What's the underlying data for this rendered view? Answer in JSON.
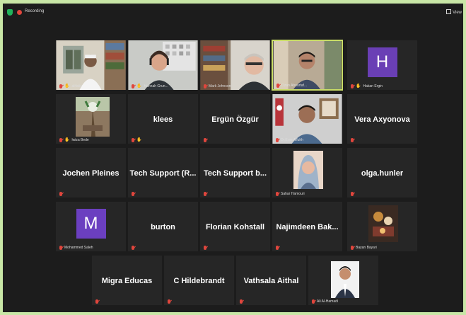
{
  "topbar": {
    "recording": "Recording",
    "view": "View"
  },
  "colors": {
    "accent_border": "#c9dd67",
    "mic_muted": "#e0463d",
    "avatar_purple": "#6a3fb5",
    "avatar_purple2": "#6b3fc0"
  },
  "participants": [
    {
      "id": "p1",
      "label": "alifatis"
    },
    {
      "id": "p2",
      "label": "Hannah Grun..."
    },
    {
      "id": "p3",
      "label": "Mark Johnson"
    },
    {
      "id": "p4",
      "label": "Ozan Abourtaf..."
    },
    {
      "id": "p5",
      "label": "Hakan Ergin",
      "avatar": "H"
    },
    {
      "id": "p6",
      "label": "lwiza Bede"
    },
    {
      "id": "p7",
      "name": "klees"
    },
    {
      "id": "p8",
      "name": "Ergün Özgür"
    },
    {
      "id": "p9",
      "label": "Dr.Eras Alfuhh"
    },
    {
      "id": "p10",
      "name": "Vera Axyonova"
    },
    {
      "id": "p11",
      "name": "Jochen Pleines"
    },
    {
      "id": "p12",
      "name": "Tech Support (R..."
    },
    {
      "id": "p13",
      "name": "Tech Support b..."
    },
    {
      "id": "p14",
      "label": "Sahar Hamouri"
    },
    {
      "id": "p15",
      "name": "olga.hunler"
    },
    {
      "id": "p16",
      "label": "Mohammed Saleh",
      "avatar": "M"
    },
    {
      "id": "p17",
      "name": "burton"
    },
    {
      "id": "p18",
      "name": "Florian Kohstall"
    },
    {
      "id": "p19",
      "name": "Najimdeen Bak..."
    },
    {
      "id": "p20",
      "label": "Bayan Bayari"
    },
    {
      "id": "p21",
      "name": "Migra Educas"
    },
    {
      "id": "p22",
      "name": "C Hildebrandt"
    },
    {
      "id": "p23",
      "name": "Vathsala Aithal"
    },
    {
      "id": "p24",
      "label": "Ali Al-Hamadi"
    }
  ]
}
